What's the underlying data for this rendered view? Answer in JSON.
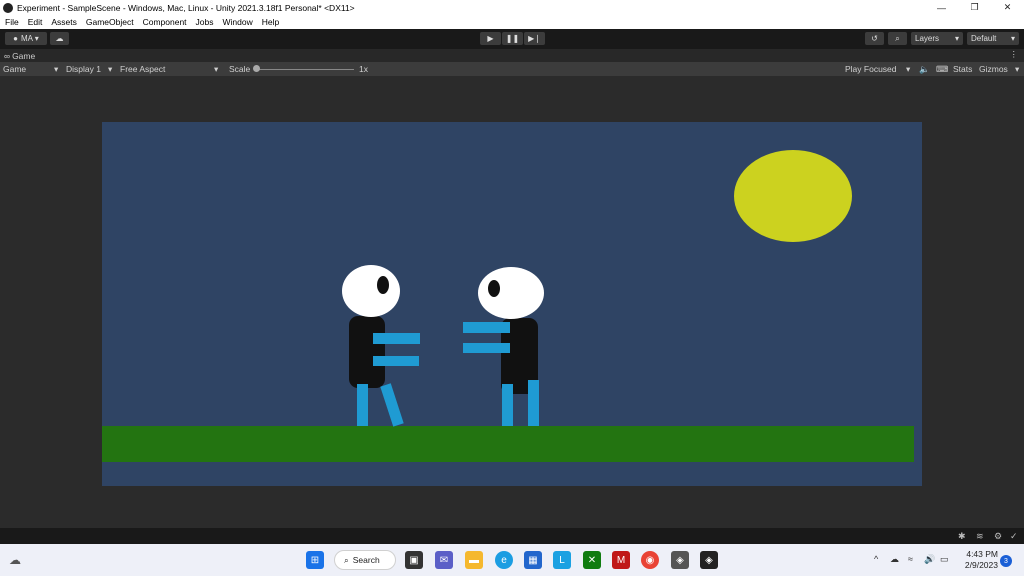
{
  "window": {
    "title": "Experiment - SampleScene - Windows, Mac, Linux - Unity 2021.3.18f1 Personal* <DX11>",
    "minimize": "—",
    "restore": "❐",
    "close": "✕"
  },
  "menu": [
    "File",
    "Edit",
    "Assets",
    "GameObject",
    "Component",
    "Jobs",
    "Window",
    "Help"
  ],
  "toolbar": {
    "account": "MA ▾",
    "layers": "Layers",
    "layout": "Default"
  },
  "game_tab": {
    "label": "Game"
  },
  "game_options": {
    "view_select": "Game",
    "display": "Display 1",
    "aspect": "Free Aspect",
    "scale_label": "Scale",
    "scale_value": "1x",
    "scale_fraction": 0.0,
    "play_mode": "Play Focused",
    "stats": "Stats",
    "gizmos": "Gizmos"
  },
  "scene": {
    "sky_color": "#2f4464",
    "ground_color": "#237411",
    "sun_color": "#ccd21f",
    "limb_color": "#1f9bd3"
  },
  "taskbar": {
    "search_label": "Search",
    "time": "4:43 PM",
    "date": "2/9/2023",
    "notification_count": "3"
  }
}
